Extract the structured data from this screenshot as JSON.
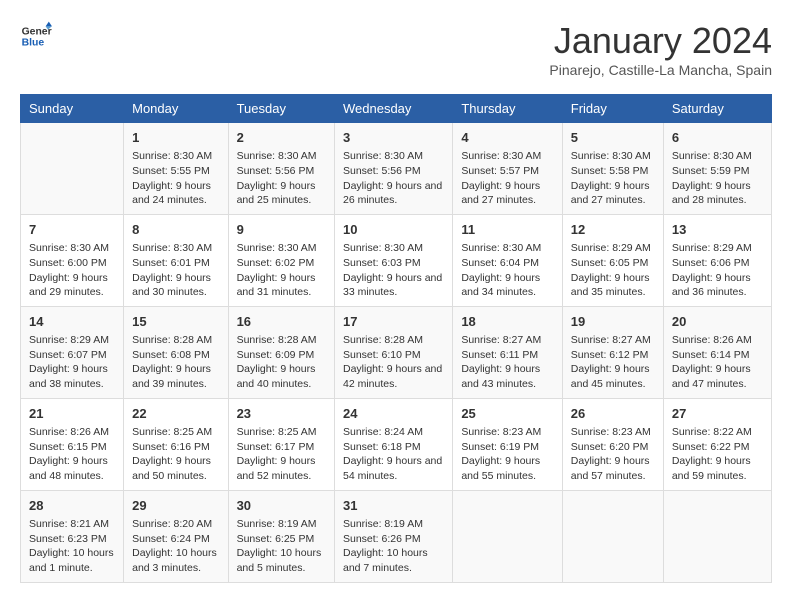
{
  "logo": {
    "line1": "General",
    "line2": "Blue"
  },
  "title": "January 2024",
  "subtitle": "Pinarejo, Castille-La Mancha, Spain",
  "days_of_week": [
    "Sunday",
    "Monday",
    "Tuesday",
    "Wednesday",
    "Thursday",
    "Friday",
    "Saturday"
  ],
  "weeks": [
    [
      {
        "num": "",
        "sunrise": "",
        "sunset": "",
        "daylight": ""
      },
      {
        "num": "1",
        "sunrise": "Sunrise: 8:30 AM",
        "sunset": "Sunset: 5:55 PM",
        "daylight": "Daylight: 9 hours and 24 minutes."
      },
      {
        "num": "2",
        "sunrise": "Sunrise: 8:30 AM",
        "sunset": "Sunset: 5:56 PM",
        "daylight": "Daylight: 9 hours and 25 minutes."
      },
      {
        "num": "3",
        "sunrise": "Sunrise: 8:30 AM",
        "sunset": "Sunset: 5:56 PM",
        "daylight": "Daylight: 9 hours and 26 minutes."
      },
      {
        "num": "4",
        "sunrise": "Sunrise: 8:30 AM",
        "sunset": "Sunset: 5:57 PM",
        "daylight": "Daylight: 9 hours and 27 minutes."
      },
      {
        "num": "5",
        "sunrise": "Sunrise: 8:30 AM",
        "sunset": "Sunset: 5:58 PM",
        "daylight": "Daylight: 9 hours and 27 minutes."
      },
      {
        "num": "6",
        "sunrise": "Sunrise: 8:30 AM",
        "sunset": "Sunset: 5:59 PM",
        "daylight": "Daylight: 9 hours and 28 minutes."
      }
    ],
    [
      {
        "num": "7",
        "sunrise": "Sunrise: 8:30 AM",
        "sunset": "Sunset: 6:00 PM",
        "daylight": "Daylight: 9 hours and 29 minutes."
      },
      {
        "num": "8",
        "sunrise": "Sunrise: 8:30 AM",
        "sunset": "Sunset: 6:01 PM",
        "daylight": "Daylight: 9 hours and 30 minutes."
      },
      {
        "num": "9",
        "sunrise": "Sunrise: 8:30 AM",
        "sunset": "Sunset: 6:02 PM",
        "daylight": "Daylight: 9 hours and 31 minutes."
      },
      {
        "num": "10",
        "sunrise": "Sunrise: 8:30 AM",
        "sunset": "Sunset: 6:03 PM",
        "daylight": "Daylight: 9 hours and 33 minutes."
      },
      {
        "num": "11",
        "sunrise": "Sunrise: 8:30 AM",
        "sunset": "Sunset: 6:04 PM",
        "daylight": "Daylight: 9 hours and 34 minutes."
      },
      {
        "num": "12",
        "sunrise": "Sunrise: 8:29 AM",
        "sunset": "Sunset: 6:05 PM",
        "daylight": "Daylight: 9 hours and 35 minutes."
      },
      {
        "num": "13",
        "sunrise": "Sunrise: 8:29 AM",
        "sunset": "Sunset: 6:06 PM",
        "daylight": "Daylight: 9 hours and 36 minutes."
      }
    ],
    [
      {
        "num": "14",
        "sunrise": "Sunrise: 8:29 AM",
        "sunset": "Sunset: 6:07 PM",
        "daylight": "Daylight: 9 hours and 38 minutes."
      },
      {
        "num": "15",
        "sunrise": "Sunrise: 8:28 AM",
        "sunset": "Sunset: 6:08 PM",
        "daylight": "Daylight: 9 hours and 39 minutes."
      },
      {
        "num": "16",
        "sunrise": "Sunrise: 8:28 AM",
        "sunset": "Sunset: 6:09 PM",
        "daylight": "Daylight: 9 hours and 40 minutes."
      },
      {
        "num": "17",
        "sunrise": "Sunrise: 8:28 AM",
        "sunset": "Sunset: 6:10 PM",
        "daylight": "Daylight: 9 hours and 42 minutes."
      },
      {
        "num": "18",
        "sunrise": "Sunrise: 8:27 AM",
        "sunset": "Sunset: 6:11 PM",
        "daylight": "Daylight: 9 hours and 43 minutes."
      },
      {
        "num": "19",
        "sunrise": "Sunrise: 8:27 AM",
        "sunset": "Sunset: 6:12 PM",
        "daylight": "Daylight: 9 hours and 45 minutes."
      },
      {
        "num": "20",
        "sunrise": "Sunrise: 8:26 AM",
        "sunset": "Sunset: 6:14 PM",
        "daylight": "Daylight: 9 hours and 47 minutes."
      }
    ],
    [
      {
        "num": "21",
        "sunrise": "Sunrise: 8:26 AM",
        "sunset": "Sunset: 6:15 PM",
        "daylight": "Daylight: 9 hours and 48 minutes."
      },
      {
        "num": "22",
        "sunrise": "Sunrise: 8:25 AM",
        "sunset": "Sunset: 6:16 PM",
        "daylight": "Daylight: 9 hours and 50 minutes."
      },
      {
        "num": "23",
        "sunrise": "Sunrise: 8:25 AM",
        "sunset": "Sunset: 6:17 PM",
        "daylight": "Daylight: 9 hours and 52 minutes."
      },
      {
        "num": "24",
        "sunrise": "Sunrise: 8:24 AM",
        "sunset": "Sunset: 6:18 PM",
        "daylight": "Daylight: 9 hours and 54 minutes."
      },
      {
        "num": "25",
        "sunrise": "Sunrise: 8:23 AM",
        "sunset": "Sunset: 6:19 PM",
        "daylight": "Daylight: 9 hours and 55 minutes."
      },
      {
        "num": "26",
        "sunrise": "Sunrise: 8:23 AM",
        "sunset": "Sunset: 6:20 PM",
        "daylight": "Daylight: 9 hours and 57 minutes."
      },
      {
        "num": "27",
        "sunrise": "Sunrise: 8:22 AM",
        "sunset": "Sunset: 6:22 PM",
        "daylight": "Daylight: 9 hours and 59 minutes."
      }
    ],
    [
      {
        "num": "28",
        "sunrise": "Sunrise: 8:21 AM",
        "sunset": "Sunset: 6:23 PM",
        "daylight": "Daylight: 10 hours and 1 minute."
      },
      {
        "num": "29",
        "sunrise": "Sunrise: 8:20 AM",
        "sunset": "Sunset: 6:24 PM",
        "daylight": "Daylight: 10 hours and 3 minutes."
      },
      {
        "num": "30",
        "sunrise": "Sunrise: 8:19 AM",
        "sunset": "Sunset: 6:25 PM",
        "daylight": "Daylight: 10 hours and 5 minutes."
      },
      {
        "num": "31",
        "sunrise": "Sunrise: 8:19 AM",
        "sunset": "Sunset: 6:26 PM",
        "daylight": "Daylight: 10 hours and 7 minutes."
      },
      {
        "num": "",
        "sunrise": "",
        "sunset": "",
        "daylight": ""
      },
      {
        "num": "",
        "sunrise": "",
        "sunset": "",
        "daylight": ""
      },
      {
        "num": "",
        "sunrise": "",
        "sunset": "",
        "daylight": ""
      }
    ]
  ]
}
